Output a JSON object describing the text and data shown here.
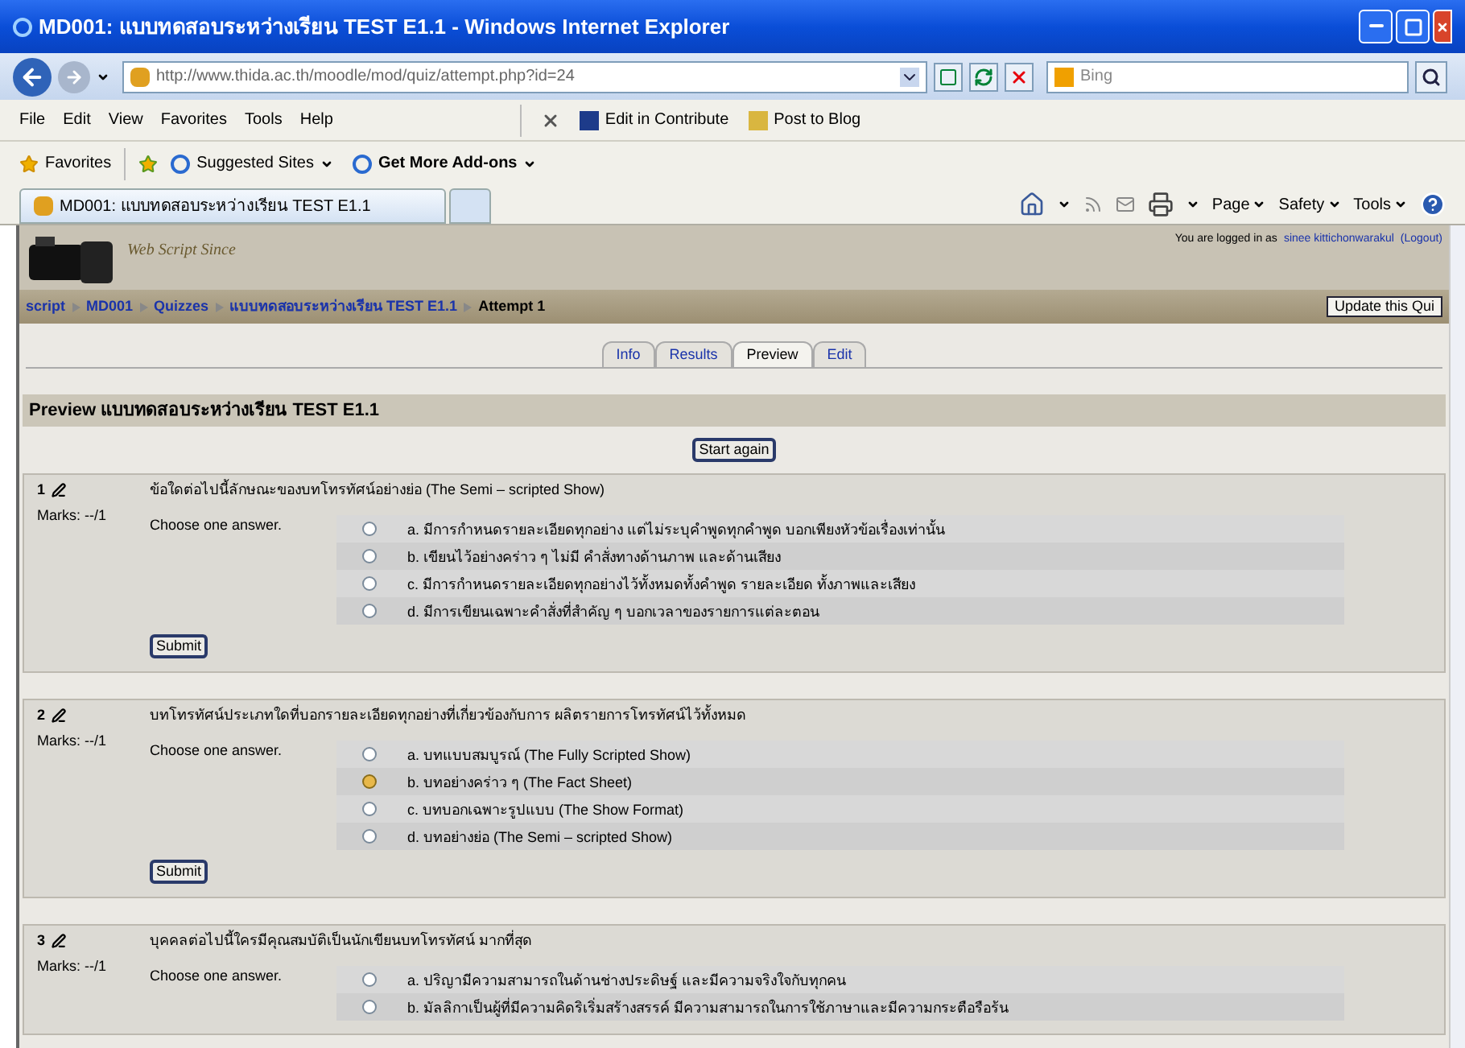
{
  "window": {
    "title": "MD001: แบบทดสอบระหว่างเรียน TEST E1.1 - Windows Internet Explorer"
  },
  "address_bar": {
    "url": "http://www.thida.ac.th/moodle/mod/quiz/attempt.php?id=24",
    "search_placeholder": "Bing"
  },
  "menu": [
    "File",
    "Edit",
    "View",
    "Favorites",
    "Tools",
    "Help"
  ],
  "command_bar": [
    "Edit in Contribute",
    "Post to Blog"
  ],
  "favorites_bar": {
    "favorites": "Favorites",
    "items": [
      "Suggested Sites",
      "Get More Add-ons"
    ]
  },
  "browser_tabs": [
    {
      "label": "MD001: แบบทดสอบระหว่างเรียน TEST E1.1",
      "selected": true
    }
  ],
  "commands": [
    "Page",
    "Safety",
    "Tools"
  ],
  "site": {
    "logo_text": "Web Script Since",
    "login_prefix": "You are logged in as",
    "user": "sinee kittichonwarakul",
    "logout": "(Logout)"
  },
  "breadcrumb": [
    "script",
    "MD001",
    "Quizzes",
    "แบบทดสอบระหว่างเรียน TEST E1.1",
    "Attempt 1"
  ],
  "update_button": "Update this Qui",
  "page_tabs": [
    {
      "label": "Info",
      "selected": false
    },
    {
      "label": "Results",
      "selected": false
    },
    {
      "label": "Preview",
      "selected": true
    },
    {
      "label": "Edit",
      "selected": false
    }
  ],
  "heading": "Preview แบบทดสอบระหว่างเรียน TEST E1.1",
  "start_again": "Start again",
  "questions": [
    {
      "number": "1",
      "marks": "Marks: --/1",
      "text": "ข้อใดต่อไปนี้ลักษณะของบทโทรทัศน์อย่างย่อ (The Semi – scripted Show)",
      "prompt": "Choose one answer.",
      "options": [
        {
          "label": "a. มีการกำหนดรายละเอียดทุกอย่าง แต่ไม่ระบุคำพูดทุกคำพูด บอกเพียงหัวข้อเรื่องเท่านั้น",
          "selected": false
        },
        {
          "label": "b. เขียนไว้อย่างคร่าว ๆ ไม่มี คำสั่งทางด้านภาพ และด้านเสียง",
          "selected": false
        },
        {
          "label": "c. มีการกำหนดรายละเอียดทุกอย่างไว้ทั้งหมดทั้งคำพูด รายละเอียด ทั้งภาพและเสียง",
          "selected": false
        },
        {
          "label": "d. มีการเขียนเฉพาะคำสั่งที่สำคัญ ๆ บอกเวลาของรายการแต่ละตอน",
          "selected": false
        }
      ],
      "submit": "Submit"
    },
    {
      "number": "2",
      "marks": "Marks: --/1",
      "text": "บทโทรทัศน์ประเภทใดที่บอกรายละเอียดทุกอย่างที่เกี่ยวข้องกับการ ผลิตรายการโทรทัศน์ไว้ทั้งหมด",
      "prompt": "Choose one answer.",
      "options": [
        {
          "label": "a. บทแบบสมบูรณ์ (The Fully Scripted Show)",
          "selected": false
        },
        {
          "label": "b. บทอย่างคร่าว ๆ (The Fact Sheet)",
          "selected": true
        },
        {
          "label": "c. บทบอกเฉพาะรูปแบบ (The Show Format)",
          "selected": false
        },
        {
          "label": "d. บทอย่างย่อ (The Semi – scripted Show)",
          "selected": false
        }
      ],
      "submit": "Submit"
    },
    {
      "number": "3",
      "marks": "Marks: --/1",
      "text": "บุคคลต่อไปนี้ใครมีคุณสมบัติเป็นนักเขียนบทโทรทัศน์ มากที่สุด",
      "prompt": "Choose one answer.",
      "options": [
        {
          "label": "a. ปริญามีความสามารถในด้านช่างประดิษฐ์ และมีความจริงใจกับทุกคน",
          "selected": false
        },
        {
          "label": "b. มัลลิกาเป็นผู้ที่มีความคิดริเริ่มสร้างสรรค์ มีความสามารถในการใช้ภาษาและมีความกระตือรือร้น",
          "selected": false
        }
      ]
    }
  ]
}
